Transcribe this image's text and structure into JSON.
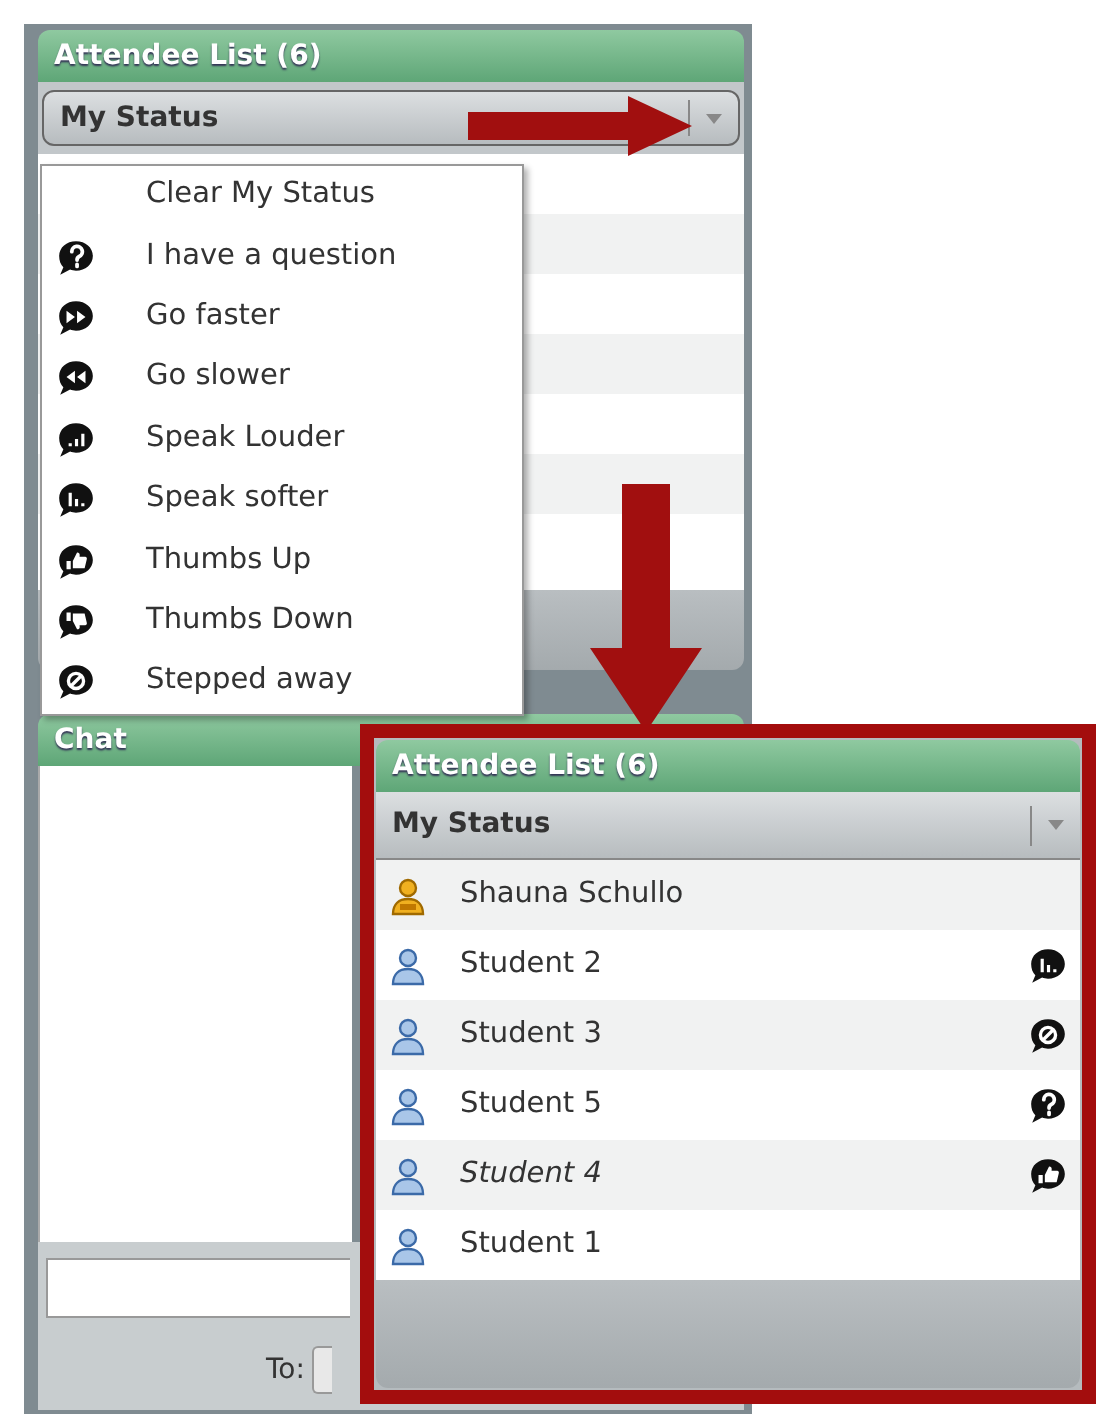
{
  "panel": {
    "title": "Attendee List (6)",
    "status_label": "My Status"
  },
  "status_menu": {
    "items": [
      {
        "label": "Clear My Status",
        "kind": "clear"
      },
      {
        "label": "I have a question",
        "kind": "question"
      },
      {
        "label": "Go faster",
        "kind": "faster"
      },
      {
        "label": "Go slower",
        "kind": "slower"
      },
      {
        "label": "Speak Louder",
        "kind": "louder"
      },
      {
        "label": "Speak softer",
        "kind": "softer"
      },
      {
        "label": "Thumbs Up",
        "kind": "thumbs_up"
      },
      {
        "label": "Thumbs Down",
        "kind": "thumbs_down"
      },
      {
        "label": "Stepped away",
        "kind": "away"
      }
    ]
  },
  "chat": {
    "title": "Chat",
    "to_label": "To:"
  },
  "inset": {
    "title": "Attendee List (6)",
    "status_label": "My Status",
    "attendees": [
      {
        "name": "Shauna Schullo",
        "kind": "host",
        "italic": false
      },
      {
        "name": "Student 2",
        "kind": "student",
        "status_icon": {
          "kind": "softer"
        },
        "italic": false
      },
      {
        "name": "Student 3",
        "kind": "student",
        "status_icon": {
          "kind": "away"
        },
        "italic": false
      },
      {
        "name": "Student 5",
        "kind": "student",
        "status_icon": {
          "kind": "question"
        },
        "italic": false
      },
      {
        "name": "Student 4",
        "kind": "student",
        "status_icon": {
          "kind": "thumbs_up"
        },
        "italic": true
      },
      {
        "name": "Student 1",
        "kind": "student",
        "italic": false
      }
    ]
  }
}
